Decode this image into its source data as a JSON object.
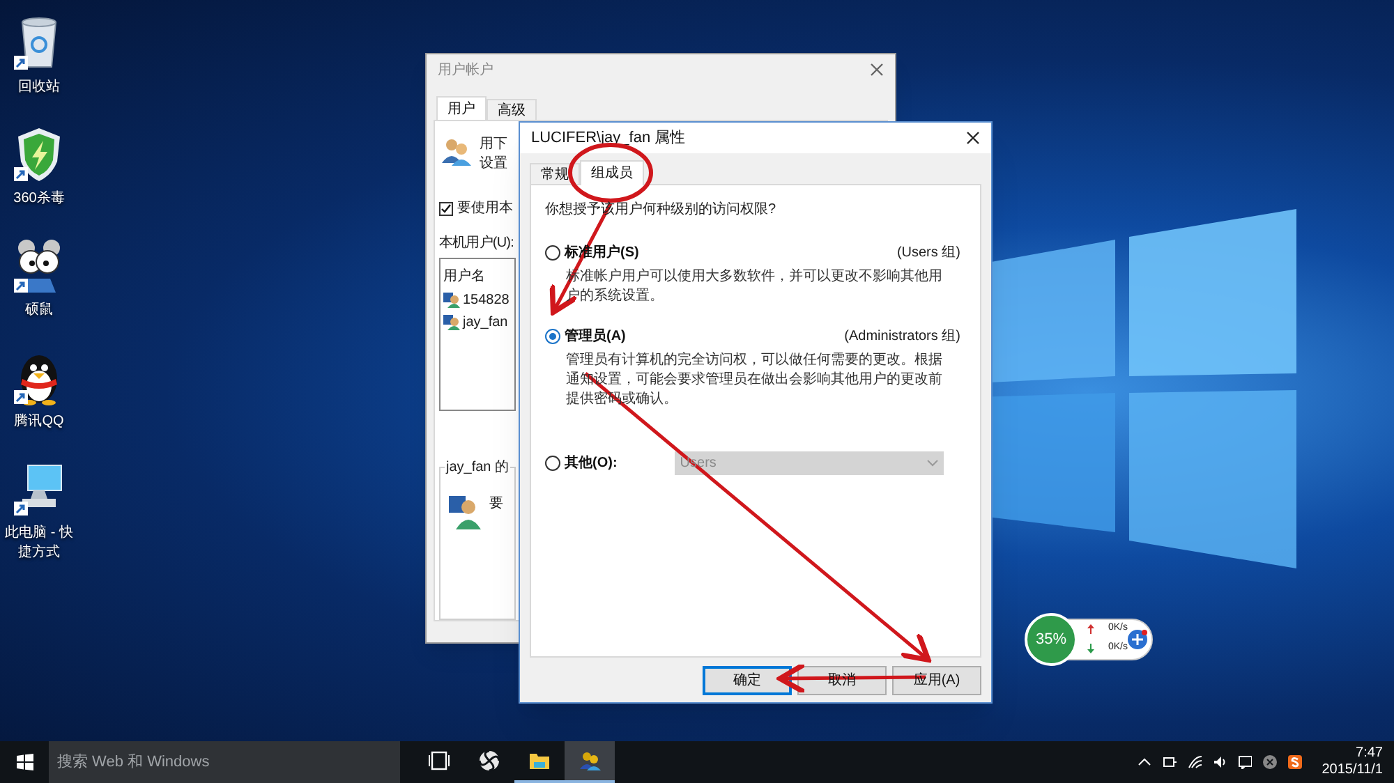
{
  "desktop_icons": [
    {
      "kind": "recycle",
      "label": "回收站"
    },
    {
      "kind": "shield",
      "label": "360杀毒"
    },
    {
      "kind": "mouse",
      "label": "硕鼠"
    },
    {
      "kind": "penguin",
      "label": "腾讯QQ"
    },
    {
      "kind": "computer",
      "label": "此电脑 - 快捷方式"
    }
  ],
  "back_window": {
    "title": "用户帐户",
    "tabs": [
      {
        "label": "用户",
        "selected": true
      },
      {
        "label": "高级",
        "selected": false
      }
    ],
    "intro_lines": [
      "用下",
      "设置"
    ],
    "checkbox": {
      "label": "要使用本",
      "checked": true
    },
    "list_label": "本机用户(U):",
    "list_header": "用户名",
    "users": [
      "154828",
      "jay_fan"
    ],
    "group_title": "jay_fan 的",
    "group_text": "要"
  },
  "dialog": {
    "title": "LUCIFER\\jay_fan 属性",
    "tabs": [
      {
        "label": "常规",
        "selected": false
      },
      {
        "label": "组成员",
        "selected": true
      }
    ],
    "question": "你想授予该用户何种级别的访问权限?",
    "options": [
      {
        "label": "标准用户(S)",
        "group": "(Users 组)",
        "description": "标准帐户用户可以使用大多数软件，并可以更改不影响其他用户的系统设置。",
        "selected": false
      },
      {
        "label": "管理员(A)",
        "group": "(Administrators 组)",
        "description": "管理员有计算机的完全访问权，可以做任何需要的更改。根据通知设置，可能会要求管理员在做出会影响其他用户的更改前提供密码或确认。",
        "selected": true
      },
      {
        "label": "其他(O):",
        "dropdown": {
          "value": "Users",
          "disabled": true
        },
        "selected": false
      }
    ],
    "buttons": [
      {
        "label": "确定",
        "default": true
      },
      {
        "label": "取消",
        "default": false
      },
      {
        "label": "应用(A)",
        "default": false
      }
    ]
  },
  "net_widget": {
    "percent": "35%",
    "upload": "0K/s",
    "download": "0K/s"
  },
  "taskbar": {
    "search_placeholder": "搜索 Web 和 Windows",
    "apps": [
      {
        "kind": "taskview",
        "running": false,
        "selected": false
      },
      {
        "kind": "pinwheel",
        "running": false,
        "selected": false
      },
      {
        "kind": "folder",
        "running": true,
        "selected": false
      },
      {
        "kind": "users",
        "running": true,
        "selected": true
      }
    ],
    "time": "7:47",
    "date": "2015/11/1"
  }
}
